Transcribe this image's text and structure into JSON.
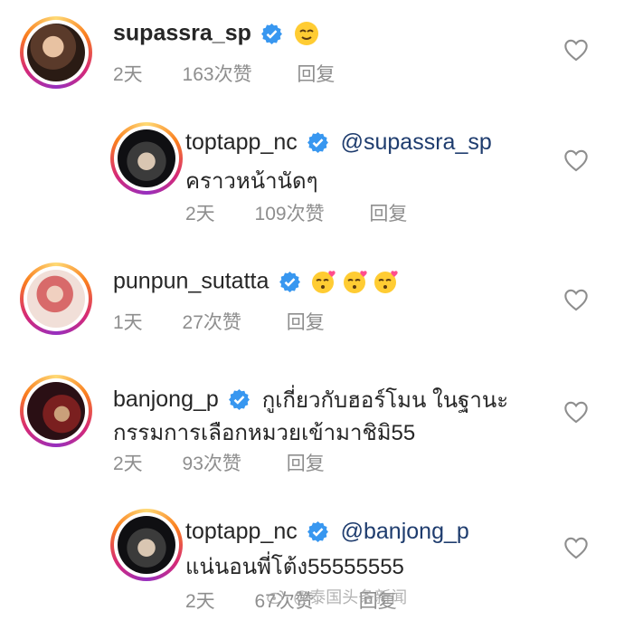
{
  "comments": [
    {
      "username": "supassra_sp",
      "verified": true,
      "mention": "",
      "text": "",
      "text2": "",
      "emojis": [
        "smiling-face-emoji"
      ],
      "time": "2天",
      "likes": "163次赞",
      "reply": "回复"
    },
    {
      "username": "toptapp_nc",
      "verified": true,
      "mention": "@supassra_sp",
      "text": "",
      "text2": "คราวหน้านัดๆ",
      "emojis": [],
      "time": "2天",
      "likes": "109次赞",
      "reply": "回复"
    },
    {
      "username": "punpun_sutatta",
      "verified": true,
      "mention": "",
      "text": "",
      "text2": "",
      "emojis": [
        "kissing-face-emoji",
        "kissing-face-emoji",
        "kissing-face-emoji"
      ],
      "time": "1天",
      "likes": "27次赞",
      "reply": "回复"
    },
    {
      "username": "banjong_p",
      "verified": true,
      "mention": "",
      "text": "กูเกี่ยวกับฮอร์โมน ในฐานะ",
      "text2": "กรรมการเลือกหมวยเข้ามาชิมิ55",
      "emojis": [],
      "time": "2天",
      "likes": "93次赞",
      "reply": "回复"
    },
    {
      "username": "toptapp_nc",
      "verified": true,
      "mention": "@banjong_p",
      "text": "",
      "text2": "แน่นอนพี่โต้ง55555555",
      "emojis": [],
      "time": "2天",
      "likes": "67次赞",
      "reply": "回复"
    }
  ],
  "watermark": "@泰国头条新闻",
  "colors": {
    "verified": "#3897f0",
    "mention": "#1e3c6e",
    "meta": "#8e8e8e",
    "heart": "#8e8e8e"
  }
}
